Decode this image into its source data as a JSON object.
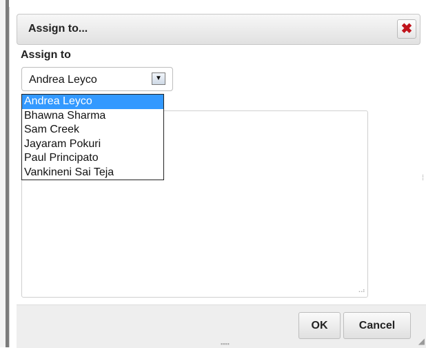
{
  "dialog": {
    "title": "Assign to...",
    "close_glyph": "✖",
    "field_label": "Assign to",
    "select": {
      "value": "Andrea Leyco",
      "options": [
        "Andrea Leyco",
        "Bhawna Sharma",
        "Sam Creek",
        "Jayaram Pokuri",
        "Paul Principato",
        "Vankineni Sai Teja"
      ],
      "highlighted_index": 0
    },
    "comment_value": "",
    "buttons": {
      "ok": "OK",
      "cancel": "Cancel"
    }
  },
  "icons": {
    "close": "close-icon",
    "dropdown_arrow": "chevron-down-icon",
    "resize": "resize-grip-icon"
  },
  "colors": {
    "highlight": "#3399ff",
    "close_red": "#c0141c",
    "footer_bg": "#eeeeee"
  }
}
